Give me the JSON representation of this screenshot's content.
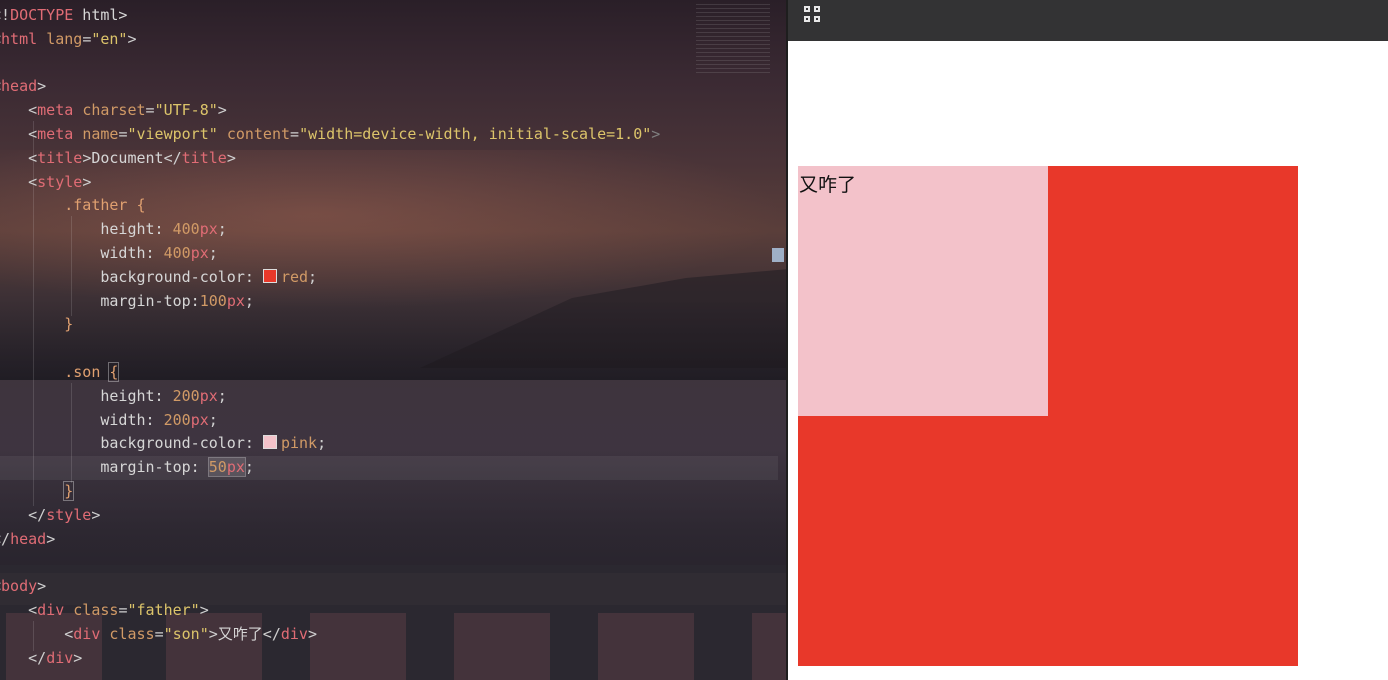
{
  "editor": {
    "lines": [
      [
        [
          "tk-punc",
          "<!"
        ],
        [
          "tk-tag",
          "DOCTYPE"
        ],
        [
          "tk-txt",
          " html>"
        ]
      ],
      [
        [
          "tk-punc",
          "<"
        ],
        [
          "tk-tag",
          "html"
        ],
        [
          "tk-txt",
          " "
        ],
        [
          "tk-attr",
          "lang"
        ],
        [
          "tk-punc",
          "="
        ],
        [
          "tk-str",
          "\"en\""
        ],
        [
          "tk-punc",
          ">"
        ]
      ],
      [],
      [
        [
          "tk-punc",
          "<"
        ],
        [
          "tk-tag",
          "head"
        ],
        [
          "tk-punc",
          ">"
        ]
      ],
      [
        [
          "tk-txt",
          "    "
        ],
        [
          "tk-punc",
          "<"
        ],
        [
          "tk-tag",
          "meta"
        ],
        [
          "tk-txt",
          " "
        ],
        [
          "tk-attr",
          "charset"
        ],
        [
          "tk-punc",
          "="
        ],
        [
          "tk-str",
          "\"UTF-8\""
        ],
        [
          "tk-punc",
          ">"
        ]
      ],
      [
        [
          "tk-txt",
          "    "
        ],
        [
          "tk-punc",
          "<"
        ],
        [
          "tk-tag",
          "meta"
        ],
        [
          "tk-txt",
          " "
        ],
        [
          "tk-attr",
          "name"
        ],
        [
          "tk-punc",
          "="
        ],
        [
          "tk-str",
          "\"viewport\""
        ],
        [
          "tk-txt",
          " "
        ],
        [
          "tk-attr",
          "content"
        ],
        [
          "tk-punc",
          "="
        ],
        [
          "tk-str",
          "\"width=device-width, initial-scale=1.0\""
        ],
        [
          "tk-dim",
          ">"
        ]
      ],
      [
        [
          "tk-txt",
          "    "
        ],
        [
          "tk-punc",
          "<"
        ],
        [
          "tk-tag",
          "title"
        ],
        [
          "tk-punc",
          ">"
        ],
        [
          "tk-txt",
          "Document"
        ],
        [
          "tk-punc",
          "</"
        ],
        [
          "tk-tag",
          "title"
        ],
        [
          "tk-punc",
          ">"
        ]
      ],
      [
        [
          "tk-txt",
          "    "
        ],
        [
          "tk-punc",
          "<"
        ],
        [
          "tk-tag",
          "style"
        ],
        [
          "tk-punc",
          ">"
        ]
      ],
      [
        [
          "tk-txt",
          "        "
        ],
        [
          "tk-sel",
          ".father {"
        ]
      ],
      [
        [
          "tk-txt",
          "            "
        ],
        [
          "tk-prop",
          "height: "
        ],
        [
          "tk-num",
          "400"
        ],
        [
          "tk-unit",
          "px"
        ],
        [
          "tk-punc",
          ";"
        ]
      ],
      [
        [
          "tk-txt",
          "            "
        ],
        [
          "tk-prop",
          "width: "
        ],
        [
          "tk-num",
          "400"
        ],
        [
          "tk-unit",
          "px"
        ],
        [
          "tk-punc",
          ";"
        ]
      ],
      [
        [
          "tk-txt",
          "            "
        ],
        [
          "tk-prop",
          "background-color: "
        ],
        [
          "swatch",
          "#e8382a"
        ],
        [
          "tk-kw",
          "red"
        ],
        [
          "tk-punc",
          ";"
        ]
      ],
      [
        [
          "tk-txt",
          "            "
        ],
        [
          "tk-prop",
          "margin-top:"
        ],
        [
          "tk-num",
          "100"
        ],
        [
          "tk-unit",
          "px"
        ],
        [
          "tk-punc",
          ";"
        ]
      ],
      [
        [
          "tk-txt",
          "        "
        ],
        [
          "tk-sel",
          "}"
        ]
      ],
      [],
      [
        [
          "tk-txt",
          "        "
        ],
        [
          "tk-sel",
          ".son "
        ],
        [
          "brace",
          "{"
        ]
      ],
      [
        [
          "tk-txt",
          "            "
        ],
        [
          "tk-prop",
          "height: "
        ],
        [
          "tk-num",
          "200"
        ],
        [
          "tk-unit",
          "px"
        ],
        [
          "tk-punc",
          ";"
        ]
      ],
      [
        [
          "tk-txt",
          "            "
        ],
        [
          "tk-prop",
          "width: "
        ],
        [
          "tk-num",
          "200"
        ],
        [
          "tk-unit",
          "px"
        ],
        [
          "tk-punc",
          ";"
        ]
      ],
      [
        [
          "tk-txt",
          "            "
        ],
        [
          "tk-prop",
          "background-color: "
        ],
        [
          "swatch",
          "#f3c2ca"
        ],
        [
          "tk-kw",
          "pink"
        ],
        [
          "tk-punc",
          ";"
        ]
      ],
      [
        [
          "tk-txt",
          "            "
        ],
        [
          "tk-prop",
          "margin-top: "
        ],
        [
          "hl",
          "50px"
        ],
        [
          "tk-punc",
          ";"
        ]
      ],
      [
        [
          "tk-txt",
          "        "
        ],
        [
          "brace",
          "}"
        ]
      ],
      [
        [
          "tk-txt",
          "    "
        ],
        [
          "tk-punc",
          "</"
        ],
        [
          "tk-tag",
          "style"
        ],
        [
          "tk-punc",
          ">"
        ]
      ],
      [
        [
          "tk-punc",
          "</"
        ],
        [
          "tk-tag",
          "head"
        ],
        [
          "tk-punc",
          ">"
        ]
      ],
      [],
      [
        [
          "tk-punc",
          "<"
        ],
        [
          "tk-tag",
          "body"
        ],
        [
          "tk-punc",
          ">"
        ]
      ],
      [
        [
          "tk-txt",
          "    "
        ],
        [
          "tk-punc",
          "<"
        ],
        [
          "tk-tag",
          "div"
        ],
        [
          "tk-txt",
          " "
        ],
        [
          "tk-attr",
          "class"
        ],
        [
          "tk-punc",
          "="
        ],
        [
          "tk-str",
          "\"father\""
        ],
        [
          "tk-punc",
          ">"
        ]
      ],
      [
        [
          "tk-txt",
          "        "
        ],
        [
          "tk-punc",
          "<"
        ],
        [
          "tk-tag",
          "div"
        ],
        [
          "tk-txt",
          " "
        ],
        [
          "tk-attr",
          "class"
        ],
        [
          "tk-punc",
          "="
        ],
        [
          "tk-str",
          "\"son\""
        ],
        [
          "tk-punc",
          ">"
        ],
        [
          "tk-txt",
          "又咋了"
        ],
        [
          "tk-punc",
          "</"
        ],
        [
          "tk-tag",
          "div"
        ],
        [
          "tk-punc",
          ">"
        ]
      ],
      [
        [
          "tk-txt",
          "    "
        ],
        [
          "tk-punc",
          "</"
        ],
        [
          "tk-tag",
          "div"
        ],
        [
          "tk-punc",
          ">"
        ]
      ]
    ],
    "active_line": 19
  },
  "preview": {
    "father_color": "#e8382a",
    "son_color": "#f3c2ca",
    "son_text": "又咋了"
  }
}
